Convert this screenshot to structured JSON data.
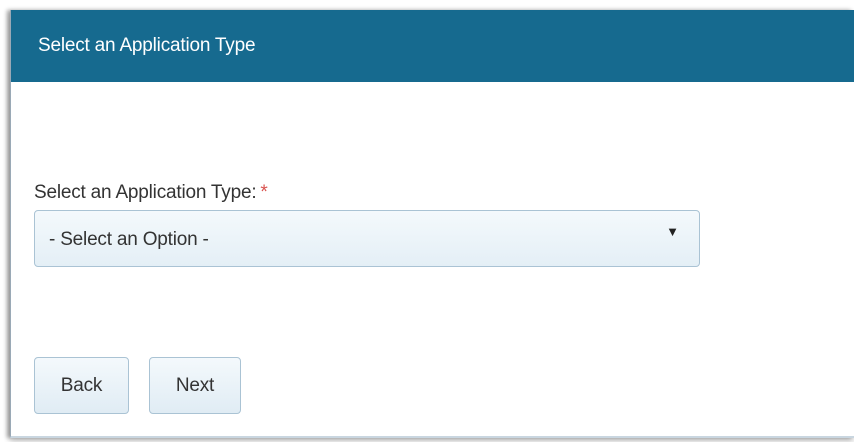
{
  "panel": {
    "title": "Select an Application Type"
  },
  "form": {
    "field_label": "Select an Application Type:",
    "required_marker": "*",
    "select": {
      "selected_value": "- Select an Option -",
      "icon": "caret-down-icon"
    }
  },
  "actions": {
    "back_label": "Back",
    "next_label": "Next"
  },
  "colors": {
    "header_bg": "#166a8f",
    "required": "#d9534f"
  }
}
